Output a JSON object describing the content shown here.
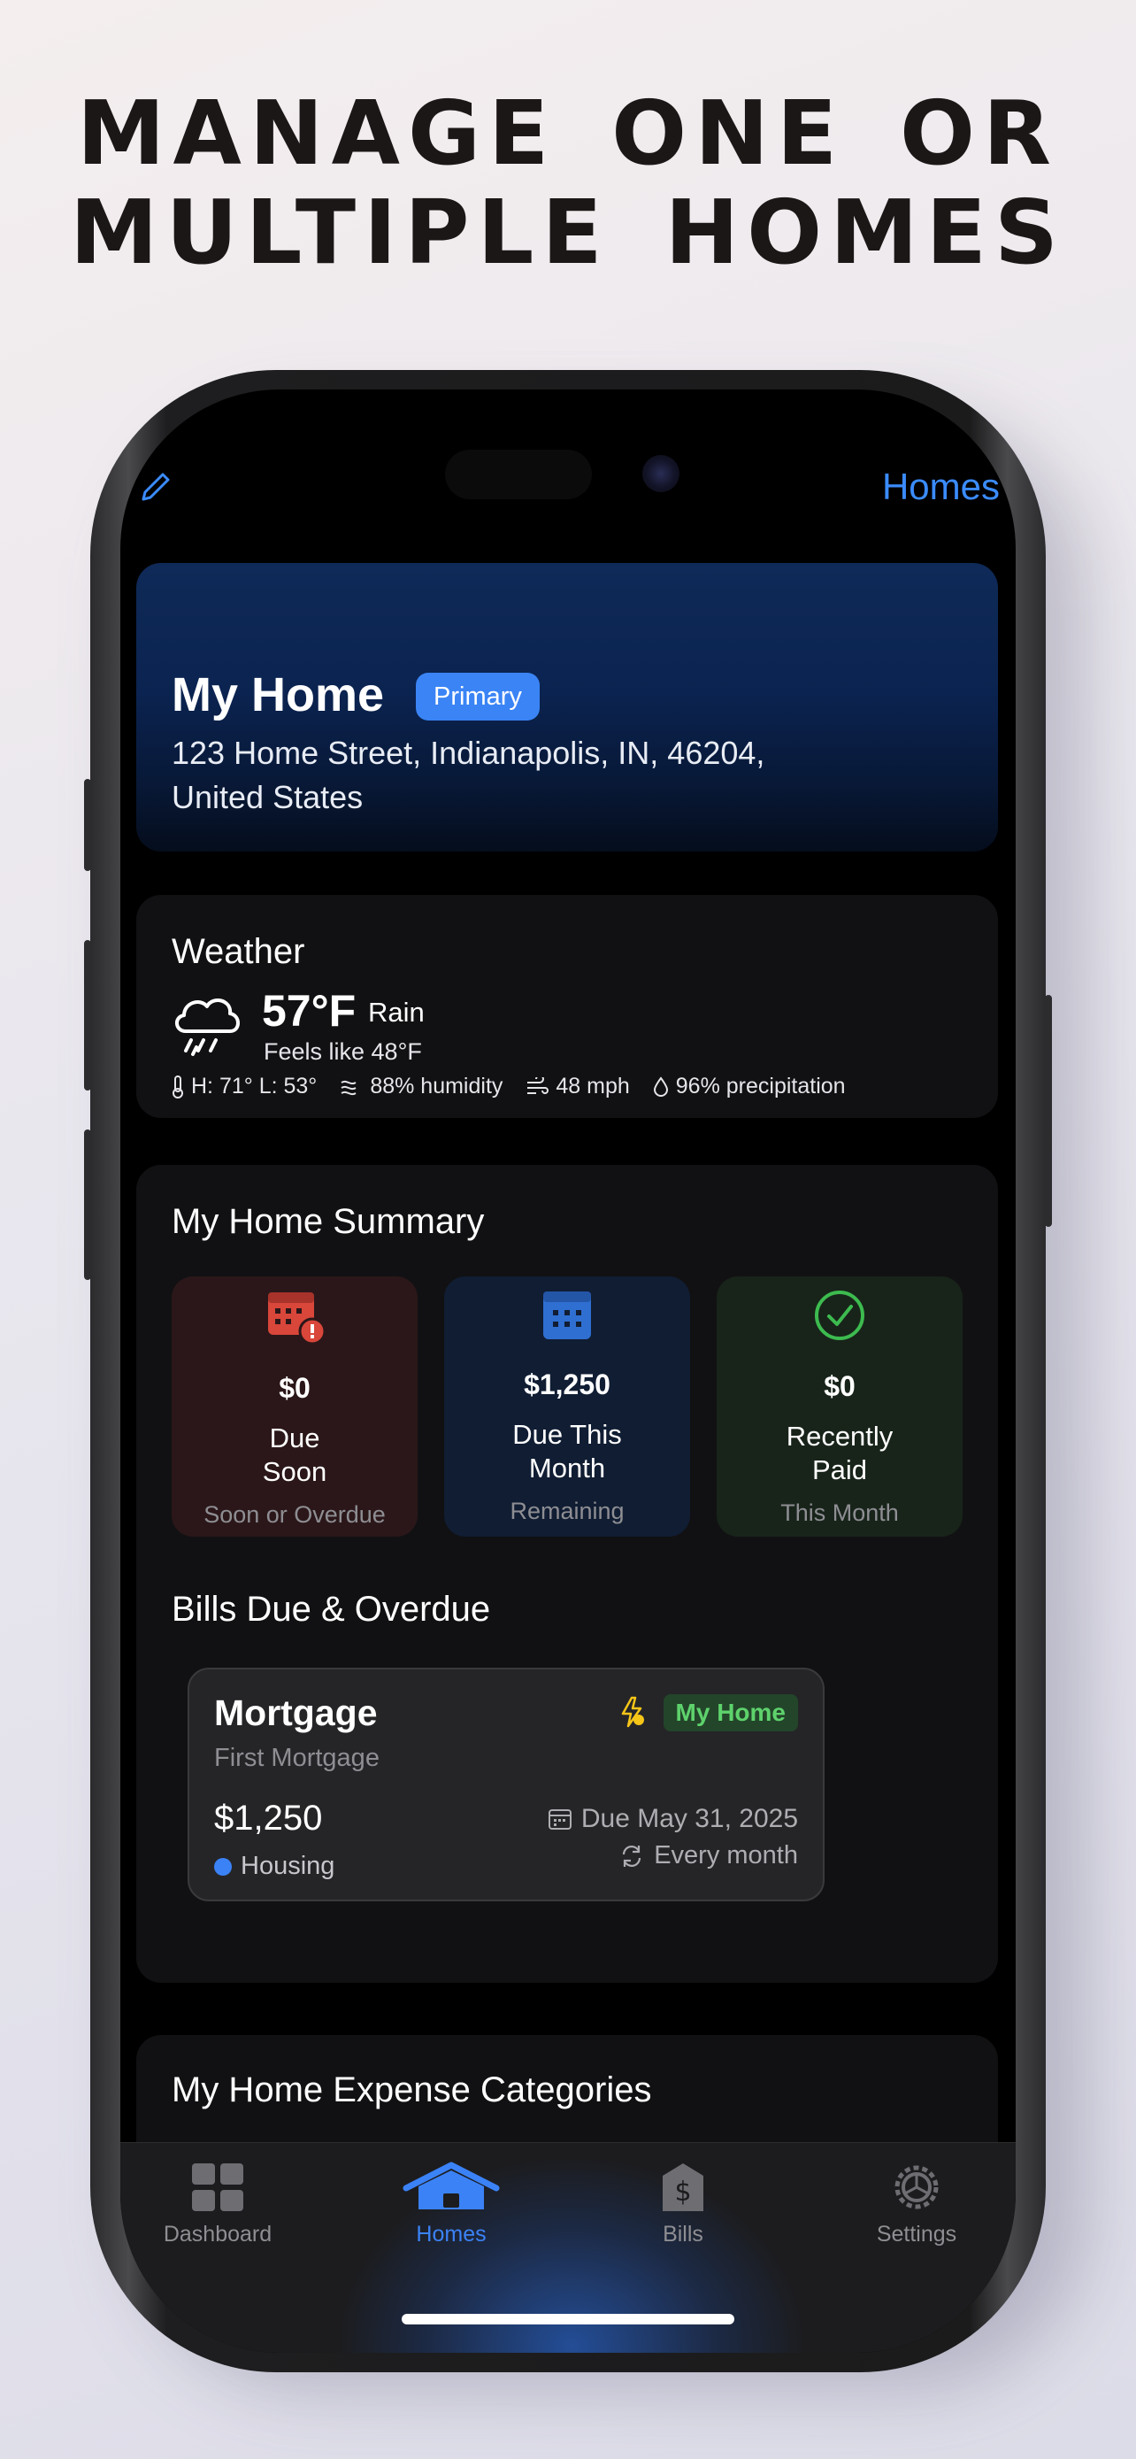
{
  "headline": {
    "line1": "MANAGE ONE OR",
    "line2": "MULTIPLE HOMES"
  },
  "nav": {
    "homes_link": "Homes",
    "edit_icon": "pencil-icon"
  },
  "home": {
    "name": "My Home",
    "badge": "Primary",
    "address": "123 Home Street, Indianapolis, IN, 46204, United States"
  },
  "weather": {
    "title": "Weather",
    "icon": "rain-cloud-icon",
    "temp": "57°F",
    "condition": "Rain",
    "feels_like": "Feels like 48°F",
    "hi_lo": "H: 71° L: 53°",
    "humidity": "88% humidity",
    "wind": "48 mph",
    "precipitation": "96% precipitation"
  },
  "summary": {
    "title": "My Home Summary",
    "tiles": [
      {
        "amount": "$0",
        "label_line1": "Due",
        "label_line2": "Soon",
        "sub": "Soon or Overdue",
        "icon": "calendar-alert-icon",
        "color": "#d9463a"
      },
      {
        "amount": "$1,250",
        "label_line1": "Due This",
        "label_line2": "Month",
        "sub": "Remaining",
        "icon": "calendar-icon",
        "color": "#3a7bd5"
      },
      {
        "amount": "$0",
        "label_line1": "Recently",
        "label_line2": "Paid",
        "sub": "This Month",
        "icon": "check-circle-icon",
        "color": "#3dbb4f"
      }
    ]
  },
  "bills": {
    "title": "Bills Due & Overdue",
    "items": [
      {
        "name": "Mortgage",
        "subtitle": "First Mortgage",
        "amount": "$1,250",
        "category": "Housing",
        "tag": "My Home",
        "due": "Due May 31, 2025",
        "repeat": "Every month"
      }
    ]
  },
  "expense": {
    "title": "My Home Expense Categories"
  },
  "tabbar": {
    "active": "Homes",
    "accent": "#3b82f6",
    "tabs": [
      {
        "label": "Dashboard",
        "icon": "grid-icon"
      },
      {
        "label": "Homes",
        "icon": "house-icon"
      },
      {
        "label": "Bills",
        "icon": "bank-icon"
      },
      {
        "label": "Settings",
        "icon": "gear-icon"
      }
    ]
  }
}
